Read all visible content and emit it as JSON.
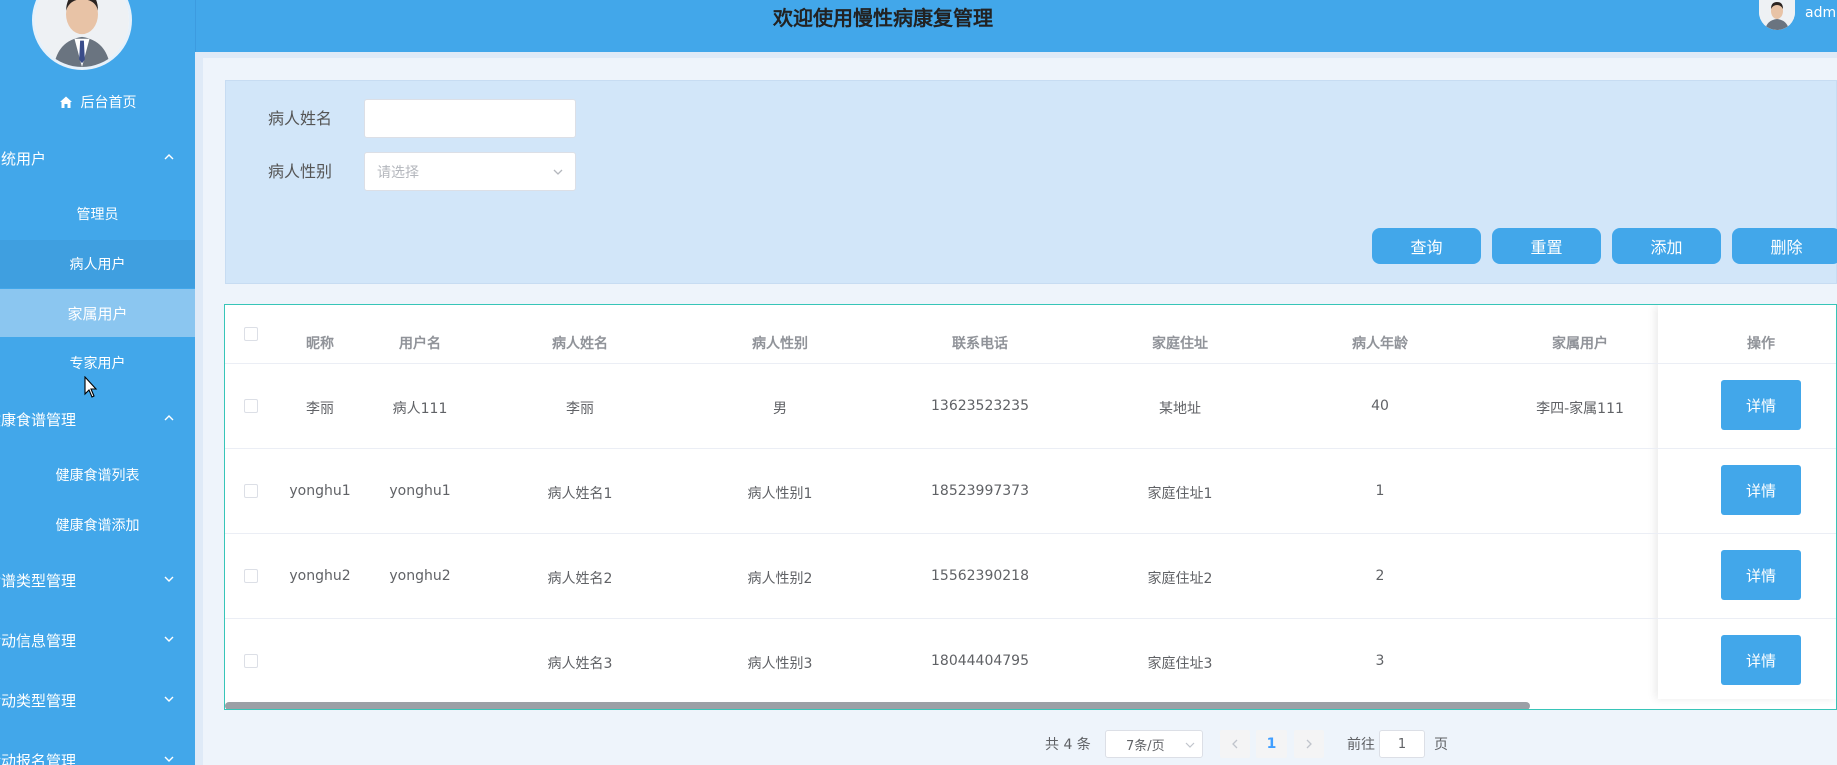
{
  "header": {
    "title": "欢迎使用慢性病康复管理",
    "user": "admin"
  },
  "sidebar": {
    "home": "后台首页",
    "groups": [
      {
        "label": "系统用户",
        "expanded": true,
        "items": [
          "管理员",
          "病人用户",
          "家属用户",
          "专家用户"
        ]
      },
      {
        "label": "健康食谱管理",
        "expanded": true,
        "items": [
          "健康食谱列表",
          "健康食谱添加"
        ]
      },
      {
        "label": "食谱类型管理",
        "expanded": false
      },
      {
        "label": "活动信息管理",
        "expanded": false
      },
      {
        "label": "活动类型管理",
        "expanded": false
      },
      {
        "label": "活动报名管理",
        "expanded": false
      }
    ],
    "active_item": "家属用户"
  },
  "search": {
    "name_label": "病人姓名",
    "name_value": "",
    "gender_label": "病人性别",
    "gender_placeholder": "请选择",
    "buttons": {
      "query": "查询",
      "reset": "重置",
      "add": "添加",
      "delete": "删除"
    }
  },
  "table": {
    "headers": [
      "昵称",
      "用户名",
      "病人姓名",
      "病人性别",
      "联系电话",
      "家庭住址",
      "病人年龄",
      "家属用户",
      "操作"
    ],
    "rows": [
      {
        "nickname": "李丽",
        "username": "病人111",
        "name": "李丽",
        "gender": "男",
        "phone": "13623523235",
        "address": "某地址",
        "age": "40",
        "family": "李四-家属111",
        "action": "详情"
      },
      {
        "nickname": "yonghu1",
        "username": "yonghu1",
        "name": "病人姓名1",
        "gender": "病人性别1",
        "phone": "18523997373",
        "address": "家庭住址1",
        "age": "1",
        "family": "",
        "action": "详情"
      },
      {
        "nickname": "yonghu2",
        "username": "yonghu2",
        "name": "病人姓名2",
        "gender": "病人性别2",
        "phone": "15562390218",
        "address": "家庭住址2",
        "age": "2",
        "family": "",
        "action": "详情"
      },
      {
        "nickname": "",
        "username": "",
        "name": "病人姓名3",
        "gender": "病人性别3",
        "phone": "18044404795",
        "address": "家庭住址3",
        "age": "3",
        "family": "",
        "action": "详情"
      }
    ]
  },
  "pagination": {
    "total": "共 4 条",
    "page_size": "7条/页",
    "current_page": "1",
    "goto_prefix": "前往",
    "goto_value": "1",
    "goto_suffix": "页"
  },
  "colors": {
    "primary": "#42a7ea",
    "active_menu": "#8bc6f0",
    "page_bg": "#eef4fb"
  }
}
